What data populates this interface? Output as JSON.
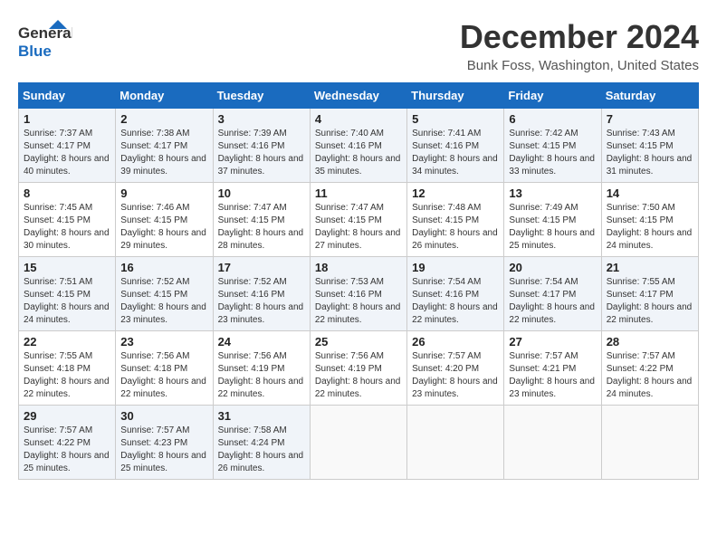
{
  "logo": {
    "text_general": "General",
    "text_blue": "Blue"
  },
  "title": "December 2024",
  "subtitle": "Bunk Foss, Washington, United States",
  "headers": [
    "Sunday",
    "Monday",
    "Tuesday",
    "Wednesday",
    "Thursday",
    "Friday",
    "Saturday"
  ],
  "weeks": [
    [
      {
        "day": "1",
        "sunrise": "Sunrise: 7:37 AM",
        "sunset": "Sunset: 4:17 PM",
        "daylight": "Daylight: 8 hours and 40 minutes."
      },
      {
        "day": "2",
        "sunrise": "Sunrise: 7:38 AM",
        "sunset": "Sunset: 4:17 PM",
        "daylight": "Daylight: 8 hours and 39 minutes."
      },
      {
        "day": "3",
        "sunrise": "Sunrise: 7:39 AM",
        "sunset": "Sunset: 4:16 PM",
        "daylight": "Daylight: 8 hours and 37 minutes."
      },
      {
        "day": "4",
        "sunrise": "Sunrise: 7:40 AM",
        "sunset": "Sunset: 4:16 PM",
        "daylight": "Daylight: 8 hours and 35 minutes."
      },
      {
        "day": "5",
        "sunrise": "Sunrise: 7:41 AM",
        "sunset": "Sunset: 4:16 PM",
        "daylight": "Daylight: 8 hours and 34 minutes."
      },
      {
        "day": "6",
        "sunrise": "Sunrise: 7:42 AM",
        "sunset": "Sunset: 4:15 PM",
        "daylight": "Daylight: 8 hours and 33 minutes."
      },
      {
        "day": "7",
        "sunrise": "Sunrise: 7:43 AM",
        "sunset": "Sunset: 4:15 PM",
        "daylight": "Daylight: 8 hours and 31 minutes."
      }
    ],
    [
      {
        "day": "8",
        "sunrise": "Sunrise: 7:45 AM",
        "sunset": "Sunset: 4:15 PM",
        "daylight": "Daylight: 8 hours and 30 minutes."
      },
      {
        "day": "9",
        "sunrise": "Sunrise: 7:46 AM",
        "sunset": "Sunset: 4:15 PM",
        "daylight": "Daylight: 8 hours and 29 minutes."
      },
      {
        "day": "10",
        "sunrise": "Sunrise: 7:47 AM",
        "sunset": "Sunset: 4:15 PM",
        "daylight": "Daylight: 8 hours and 28 minutes."
      },
      {
        "day": "11",
        "sunrise": "Sunrise: 7:47 AM",
        "sunset": "Sunset: 4:15 PM",
        "daylight": "Daylight: 8 hours and 27 minutes."
      },
      {
        "day": "12",
        "sunrise": "Sunrise: 7:48 AM",
        "sunset": "Sunset: 4:15 PM",
        "daylight": "Daylight: 8 hours and 26 minutes."
      },
      {
        "day": "13",
        "sunrise": "Sunrise: 7:49 AM",
        "sunset": "Sunset: 4:15 PM",
        "daylight": "Daylight: 8 hours and 25 minutes."
      },
      {
        "day": "14",
        "sunrise": "Sunrise: 7:50 AM",
        "sunset": "Sunset: 4:15 PM",
        "daylight": "Daylight: 8 hours and 24 minutes."
      }
    ],
    [
      {
        "day": "15",
        "sunrise": "Sunrise: 7:51 AM",
        "sunset": "Sunset: 4:15 PM",
        "daylight": "Daylight: 8 hours and 24 minutes."
      },
      {
        "day": "16",
        "sunrise": "Sunrise: 7:52 AM",
        "sunset": "Sunset: 4:15 PM",
        "daylight": "Daylight: 8 hours and 23 minutes."
      },
      {
        "day": "17",
        "sunrise": "Sunrise: 7:52 AM",
        "sunset": "Sunset: 4:16 PM",
        "daylight": "Daylight: 8 hours and 23 minutes."
      },
      {
        "day": "18",
        "sunrise": "Sunrise: 7:53 AM",
        "sunset": "Sunset: 4:16 PM",
        "daylight": "Daylight: 8 hours and 22 minutes."
      },
      {
        "day": "19",
        "sunrise": "Sunrise: 7:54 AM",
        "sunset": "Sunset: 4:16 PM",
        "daylight": "Daylight: 8 hours and 22 minutes."
      },
      {
        "day": "20",
        "sunrise": "Sunrise: 7:54 AM",
        "sunset": "Sunset: 4:17 PM",
        "daylight": "Daylight: 8 hours and 22 minutes."
      },
      {
        "day": "21",
        "sunrise": "Sunrise: 7:55 AM",
        "sunset": "Sunset: 4:17 PM",
        "daylight": "Daylight: 8 hours and 22 minutes."
      }
    ],
    [
      {
        "day": "22",
        "sunrise": "Sunrise: 7:55 AM",
        "sunset": "Sunset: 4:18 PM",
        "daylight": "Daylight: 8 hours and 22 minutes."
      },
      {
        "day": "23",
        "sunrise": "Sunrise: 7:56 AM",
        "sunset": "Sunset: 4:18 PM",
        "daylight": "Daylight: 8 hours and 22 minutes."
      },
      {
        "day": "24",
        "sunrise": "Sunrise: 7:56 AM",
        "sunset": "Sunset: 4:19 PM",
        "daylight": "Daylight: 8 hours and 22 minutes."
      },
      {
        "day": "25",
        "sunrise": "Sunrise: 7:56 AM",
        "sunset": "Sunset: 4:19 PM",
        "daylight": "Daylight: 8 hours and 22 minutes."
      },
      {
        "day": "26",
        "sunrise": "Sunrise: 7:57 AM",
        "sunset": "Sunset: 4:20 PM",
        "daylight": "Daylight: 8 hours and 23 minutes."
      },
      {
        "day": "27",
        "sunrise": "Sunrise: 7:57 AM",
        "sunset": "Sunset: 4:21 PM",
        "daylight": "Daylight: 8 hours and 23 minutes."
      },
      {
        "day": "28",
        "sunrise": "Sunrise: 7:57 AM",
        "sunset": "Sunset: 4:22 PM",
        "daylight": "Daylight: 8 hours and 24 minutes."
      }
    ],
    [
      {
        "day": "29",
        "sunrise": "Sunrise: 7:57 AM",
        "sunset": "Sunset: 4:22 PM",
        "daylight": "Daylight: 8 hours and 25 minutes."
      },
      {
        "day": "30",
        "sunrise": "Sunrise: 7:57 AM",
        "sunset": "Sunset: 4:23 PM",
        "daylight": "Daylight: 8 hours and 25 minutes."
      },
      {
        "day": "31",
        "sunrise": "Sunrise: 7:58 AM",
        "sunset": "Sunset: 4:24 PM",
        "daylight": "Daylight: 8 hours and 26 minutes."
      },
      null,
      null,
      null,
      null
    ]
  ]
}
